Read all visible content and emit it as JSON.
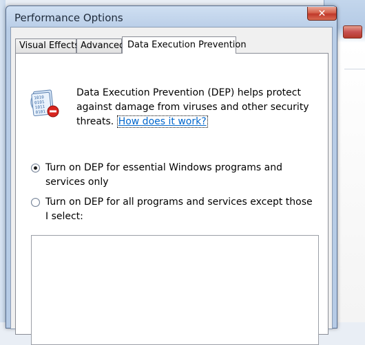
{
  "window": {
    "title": "Performance Options",
    "close_glyph": "✕"
  },
  "tabs": [
    {
      "label": "Visual Effects",
      "active": false
    },
    {
      "label": "Advanced",
      "active": false
    },
    {
      "label": "Data Execution Prevention",
      "active": true
    }
  ],
  "dep": {
    "icon": "dep-binary-shield-icon",
    "description": "Data Execution Prevention (DEP) helps protect against damage from viruses and other security threats. ",
    "link_text": "How does it work?"
  },
  "options": [
    {
      "label": "Turn on DEP for essential Windows programs and services only",
      "checked": true
    },
    {
      "label": "Turn on DEP for all programs and services except those I select:",
      "checked": false
    }
  ],
  "program_list": [],
  "colors": {
    "link": "#0066cc",
    "close_button": "#c0392b",
    "title_bar": "#b8cde7"
  }
}
